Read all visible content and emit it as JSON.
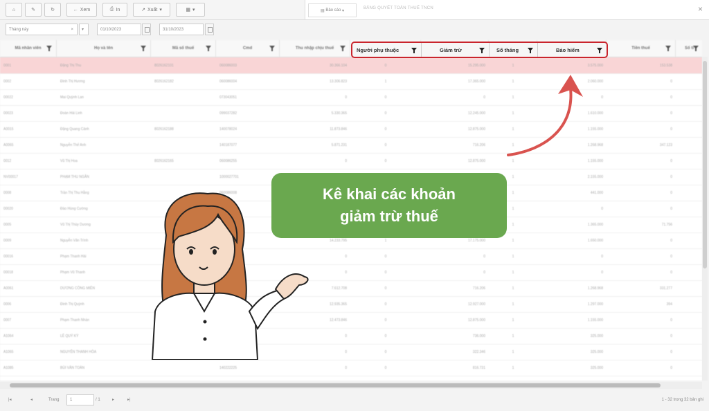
{
  "toolbar": {
    "view_label": "Xem",
    "print_label": "In",
    "export_label": "Xuất",
    "period_select": "Bảo cáo",
    "report_title": "BẢNG QUYẾT TOÁN THUẾ TNCN"
  },
  "filters": {
    "period_value": "Tháng này",
    "from_date": "01/10/2023",
    "to_date": "31/10/2023"
  },
  "columns": [
    "Mã nhân viên",
    "Họ và tên",
    "Mã số thuế",
    "Cmd",
    "Thu nhập chịu thuế",
    "",
    "",
    "",
    "",
    "Tiền thuế",
    "Số ti"
  ],
  "highlighted_columns": [
    "Người phụ thuộc",
    "Giảm trừ",
    "Số tháng",
    "Bảo hiểm"
  ],
  "rows": [
    [
      "0001",
      "Đặng Thị Thu",
      "8026162101",
      "060086003",
      "30.366.104",
      "0",
      "15.295.000",
      "1",
      "3.575.000",
      "153.538"
    ],
    [
      "0002",
      "Đinh Thị Hương",
      "8026162182",
      "060086004",
      "13.306.823",
      "1",
      "17.365.000",
      "1",
      "2.060.000",
      "0"
    ],
    [
      "00022",
      "Mai Quỳnh Lan",
      "",
      "073043051",
      "0",
      "0",
      "0",
      "1",
      "0",
      "0"
    ],
    [
      "00023",
      "Đoàn Hải Linh",
      "",
      "099037282",
      "5.330.365",
      "0",
      "12.245.000",
      "1",
      "1.610.000",
      "0"
    ],
    [
      "A0015",
      "Đặng Quang Cảnh",
      "8026162188",
      "140078024",
      "11.873.846",
      "0",
      "12.875.000",
      "1",
      "1.155.000",
      "0"
    ],
    [
      "A0065",
      "Nguyễn Thế Anh",
      "",
      "140187077",
      "5.871.231",
      "0",
      "716.206",
      "1",
      "1.268.968",
      "347.123"
    ],
    [
      "0012",
      "Vũ Thị Hoa",
      "8026162165",
      "060086255",
      "0",
      "0",
      "12.875.000",
      "1",
      "1.155.000",
      "0"
    ],
    [
      "NV00017",
      "PHẠM THU NGÂN",
      "",
      "1000027701",
      "",
      "",
      "",
      "1",
      "2.155.000",
      "0"
    ],
    [
      "0008",
      "Trần Thị Thu Hằng",
      "",
      "060086008",
      "",
      "",
      "",
      "1",
      "441.000",
      "0"
    ],
    [
      "00020",
      "Đào Hùng Cường",
      "",
      "001079782",
      "",
      "",
      "",
      "1",
      "0",
      "0"
    ],
    [
      "0005",
      "Vũ Thị Thùy Dương",
      "",
      "",
      "",
      "",
      "",
      "1",
      "1.365.000",
      "71.756"
    ],
    [
      "0009",
      "Nguyễn Văn Trình",
      "",
      "",
      "14.233.795",
      "1",
      "17.175.000",
      "1",
      "1.650.000",
      "0"
    ],
    [
      "00016",
      "Phạm Thanh Hải",
      "",
      "",
      "0",
      "0",
      "0",
      "1",
      "0",
      "0"
    ],
    [
      "00018",
      "Phạm Vũ Thanh",
      "",
      "",
      "0",
      "0",
      "0",
      "1",
      "0",
      "0"
    ],
    [
      "A0061",
      "DƯƠNG CÔNG MIỄN",
      "",
      "",
      "7.612.708",
      "0",
      "716.206",
      "1",
      "1.268.968",
      "331.277"
    ],
    [
      "0006",
      "Đinh Thị Quỳnh",
      "",
      "",
      "12.935.365",
      "0",
      "12.927.000",
      "1",
      "1.297.000",
      "394"
    ],
    [
      "0007",
      "Phạm Thanh Nhàn",
      "",
      "",
      "12.473.846",
      "0",
      "12.875.000",
      "1",
      "1.155.000",
      "0"
    ],
    [
      "A1064",
      "LÊ QUÝ KỲ",
      "",
      "",
      "0",
      "0",
      "736.000",
      "1",
      "325.000",
      "0"
    ],
    [
      "A1065",
      "NGUYỄN THANH HÒA",
      "",
      "140127817",
      "0",
      "0",
      "322.346",
      "1",
      "325.000",
      "0"
    ],
    [
      "A1085",
      "BÙI VĂN TOÀN",
      "",
      "140222225",
      "0",
      "0",
      "816.731",
      "1",
      "325.000",
      "0"
    ]
  ],
  "pager": {
    "page_label": "Trang",
    "page_value": "1",
    "of_label": "/ 1",
    "summary": "1 - 32 trong 32 bản ghi"
  },
  "callout": {
    "line1": "Kê khai các khoản",
    "line2": "giảm trừ thuế"
  },
  "colors": {
    "highlight_border": "#c9252d",
    "callout_bg": "#6aa84f",
    "arrow": "#d9534f",
    "selected_row": "#f9d5d6"
  }
}
